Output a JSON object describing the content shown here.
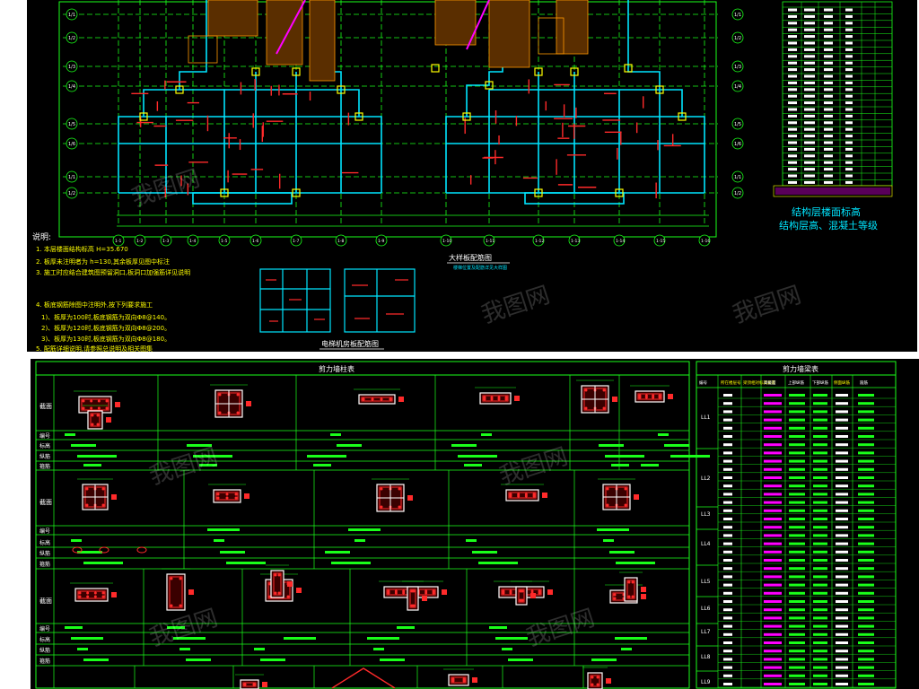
{
  "chart_data": {
    "type": "cad-drawing",
    "grid_labels_left": [
      "1/1",
      "1/2",
      "1/3",
      "1/4",
      "1/5",
      "1/6"
    ],
    "grid_labels_bottom": [
      "1-1",
      "1-2",
      "1-3",
      "1-4",
      "1-5",
      "1-6",
      "1-7",
      "1-8",
      "1-9",
      "1-10",
      "1-11",
      "1-12",
      "1-13",
      "1-14",
      "1-15",
      "1-16"
    ],
    "notes_header": "说明:",
    "notes": [
      "1. 本层楼面结构标高 H=35.670",
      "2. 板厚未注明者为 h=130,其余板厚见图中标注",
      "3. 施工时应结合建筑图预留洞口,板洞口加强筋详见说明",
      "4. 板底钢筋除图中注明外,按下列要求施工",
      "1)、板厚为100时,板底钢筋为双向Φ8@140。",
      "2)、板厚为120时,板底钢筋为双向Φ8@200。",
      "3)、板厚为130时,板底钢筋为双向Φ8@180。",
      "5. 配筋详细说明,请参照总说明及相关图集"
    ],
    "detail_title_a": "大样板配筋图",
    "detail_sub_a": "楼梯位置及配筋详见大样图",
    "detail_title_b": "电梯机房板配筋图",
    "level_table_title_1": "结构层楼面标高",
    "level_table_title_2": "结构层高、混凝土等级",
    "title_left": "剪力墙柱表",
    "title_right": "剪力墙梁表",
    "col_row_labels": [
      "截面",
      "编号",
      "标高",
      "纵筋",
      "箍筋"
    ],
    "beam_headers": [
      "编号",
      "所在楼层号",
      "梁顶相对标高高差",
      "梁截面",
      "上部纵筋",
      "下部纵筋",
      "侧面纵筋",
      "箍筋"
    ],
    "beam_ids": [
      "LL1",
      "LL2",
      "LL3",
      "LL4",
      "LL5",
      "LL6",
      "LL7",
      "LL8",
      "LL9"
    ],
    "watermark": "我图网"
  }
}
